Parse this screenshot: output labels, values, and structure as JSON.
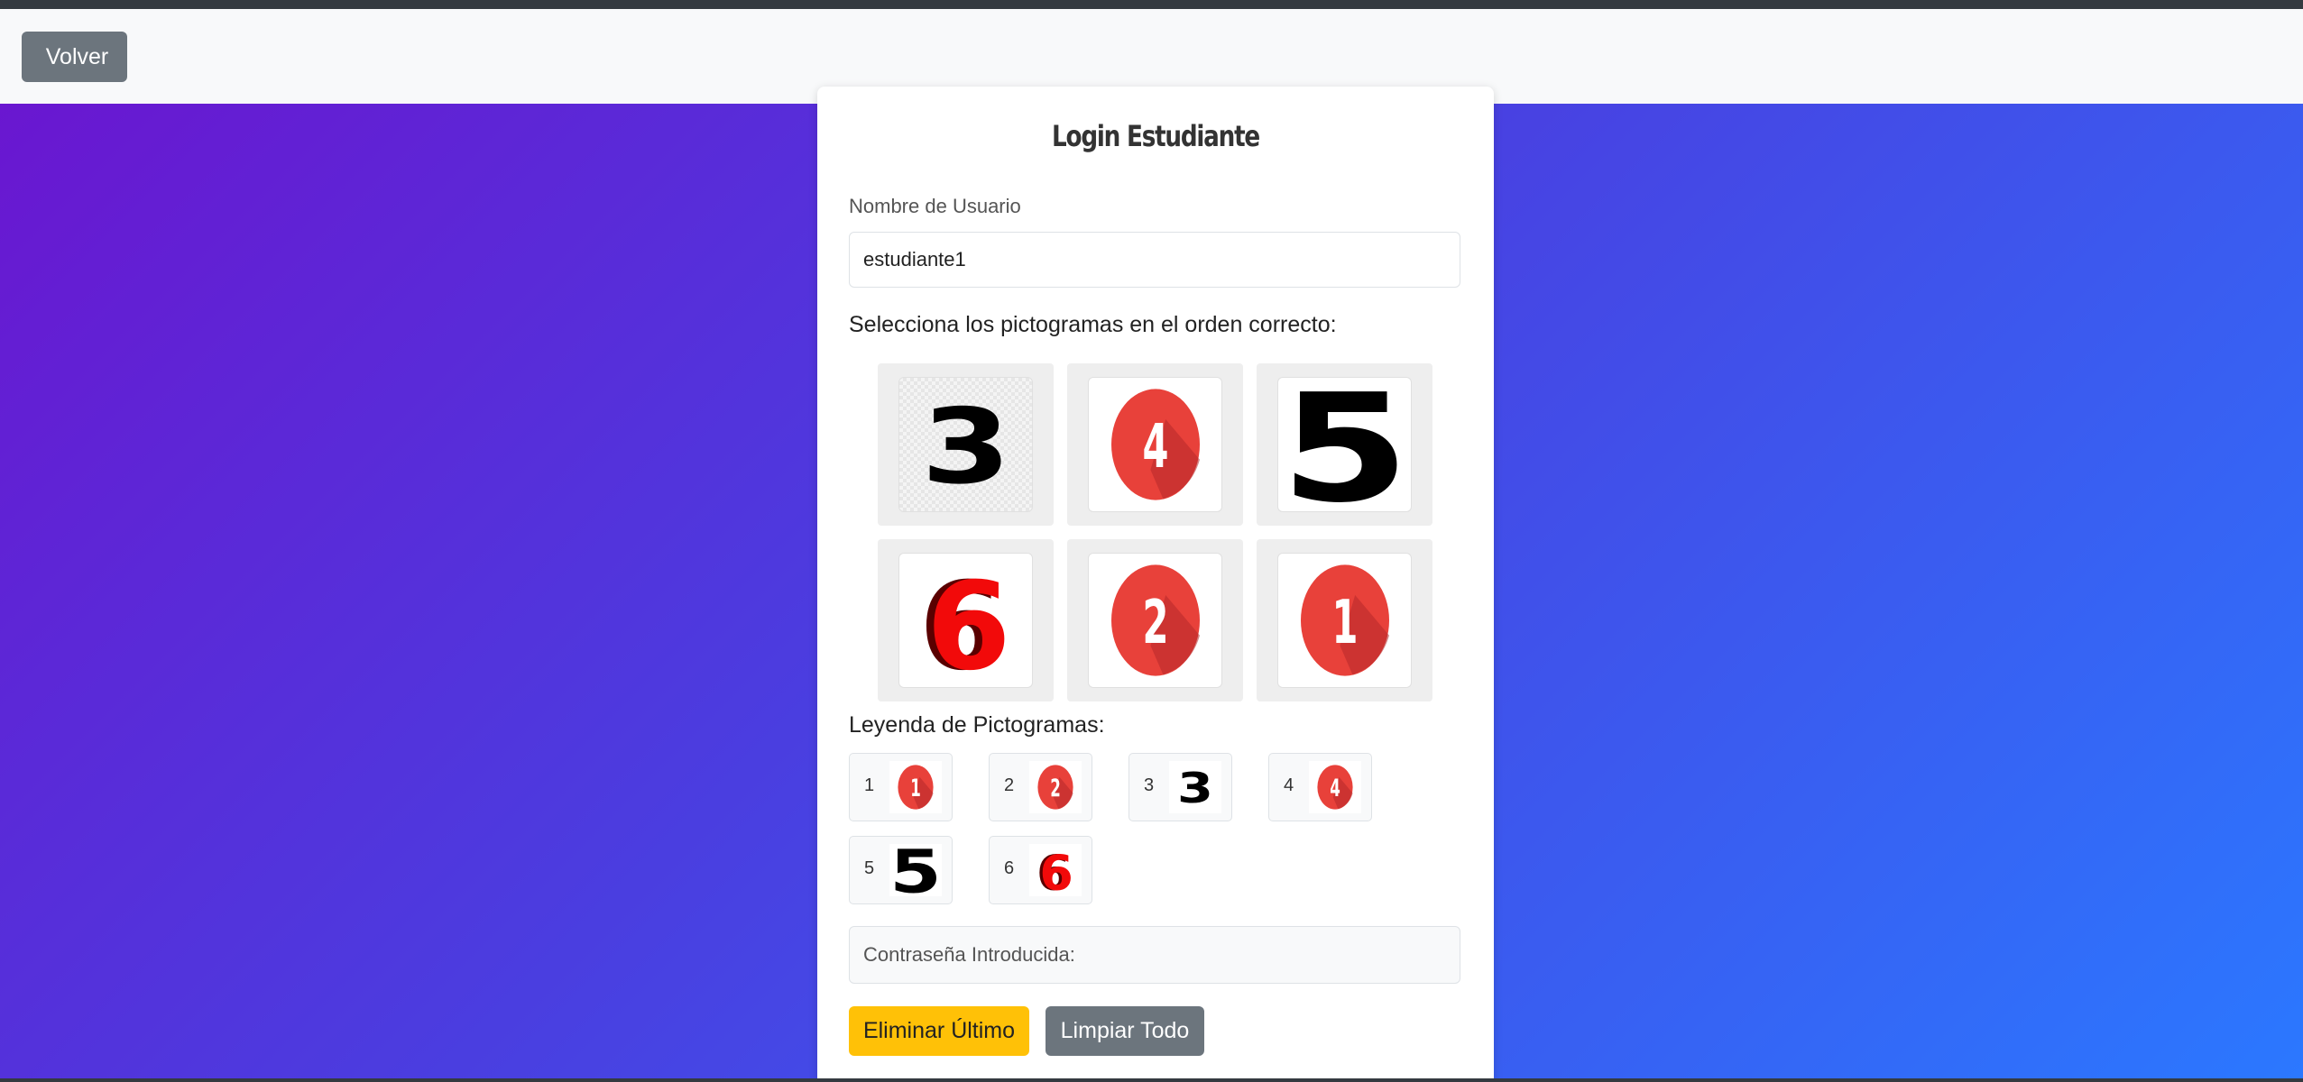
{
  "nav": {
    "back_label": "Volver"
  },
  "login": {
    "title": "Login Estudiante",
    "username_label": "Nombre de Usuario",
    "username_value": "estudiante1",
    "instruction": "Selecciona los pictogramas en el orden correcto:",
    "pictograms": [
      {
        "number": "3",
        "style": "black-on-checker",
        "icon": "number-3-pictogram-icon"
      },
      {
        "number": "4",
        "style": "red-circle",
        "icon": "number-4-pictogram-icon"
      },
      {
        "number": "5",
        "style": "black-large",
        "icon": "number-5-pictogram-icon"
      },
      {
        "number": "6",
        "style": "red-3d",
        "icon": "number-6-pictogram-icon"
      },
      {
        "number": "2",
        "style": "red-circle",
        "icon": "number-2-pictogram-icon"
      },
      {
        "number": "1",
        "style": "red-circle",
        "icon": "number-1-pictogram-icon"
      }
    ],
    "legend_title": "Leyenda de Pictogramas:",
    "legend": [
      {
        "label": "1",
        "number": "1",
        "style": "red-circle"
      },
      {
        "label": "2",
        "number": "2",
        "style": "red-circle"
      },
      {
        "label": "3",
        "number": "3",
        "style": "black-plain"
      },
      {
        "label": "4",
        "number": "4",
        "style": "red-circle"
      },
      {
        "label": "5",
        "number": "5",
        "style": "black-large"
      },
      {
        "label": "6",
        "number": "6",
        "style": "red-3d"
      }
    ],
    "password_label": "Contraseña Introducida:",
    "delete_last_label": "Eliminar Último",
    "clear_all_label": "Limpiar Todo"
  },
  "colors": {
    "gradient_start": "#6c14cf",
    "gradient_end": "#2b78ff",
    "warning": "#ffc107",
    "secondary": "#6c757d",
    "picto_red": "#e8413a"
  }
}
